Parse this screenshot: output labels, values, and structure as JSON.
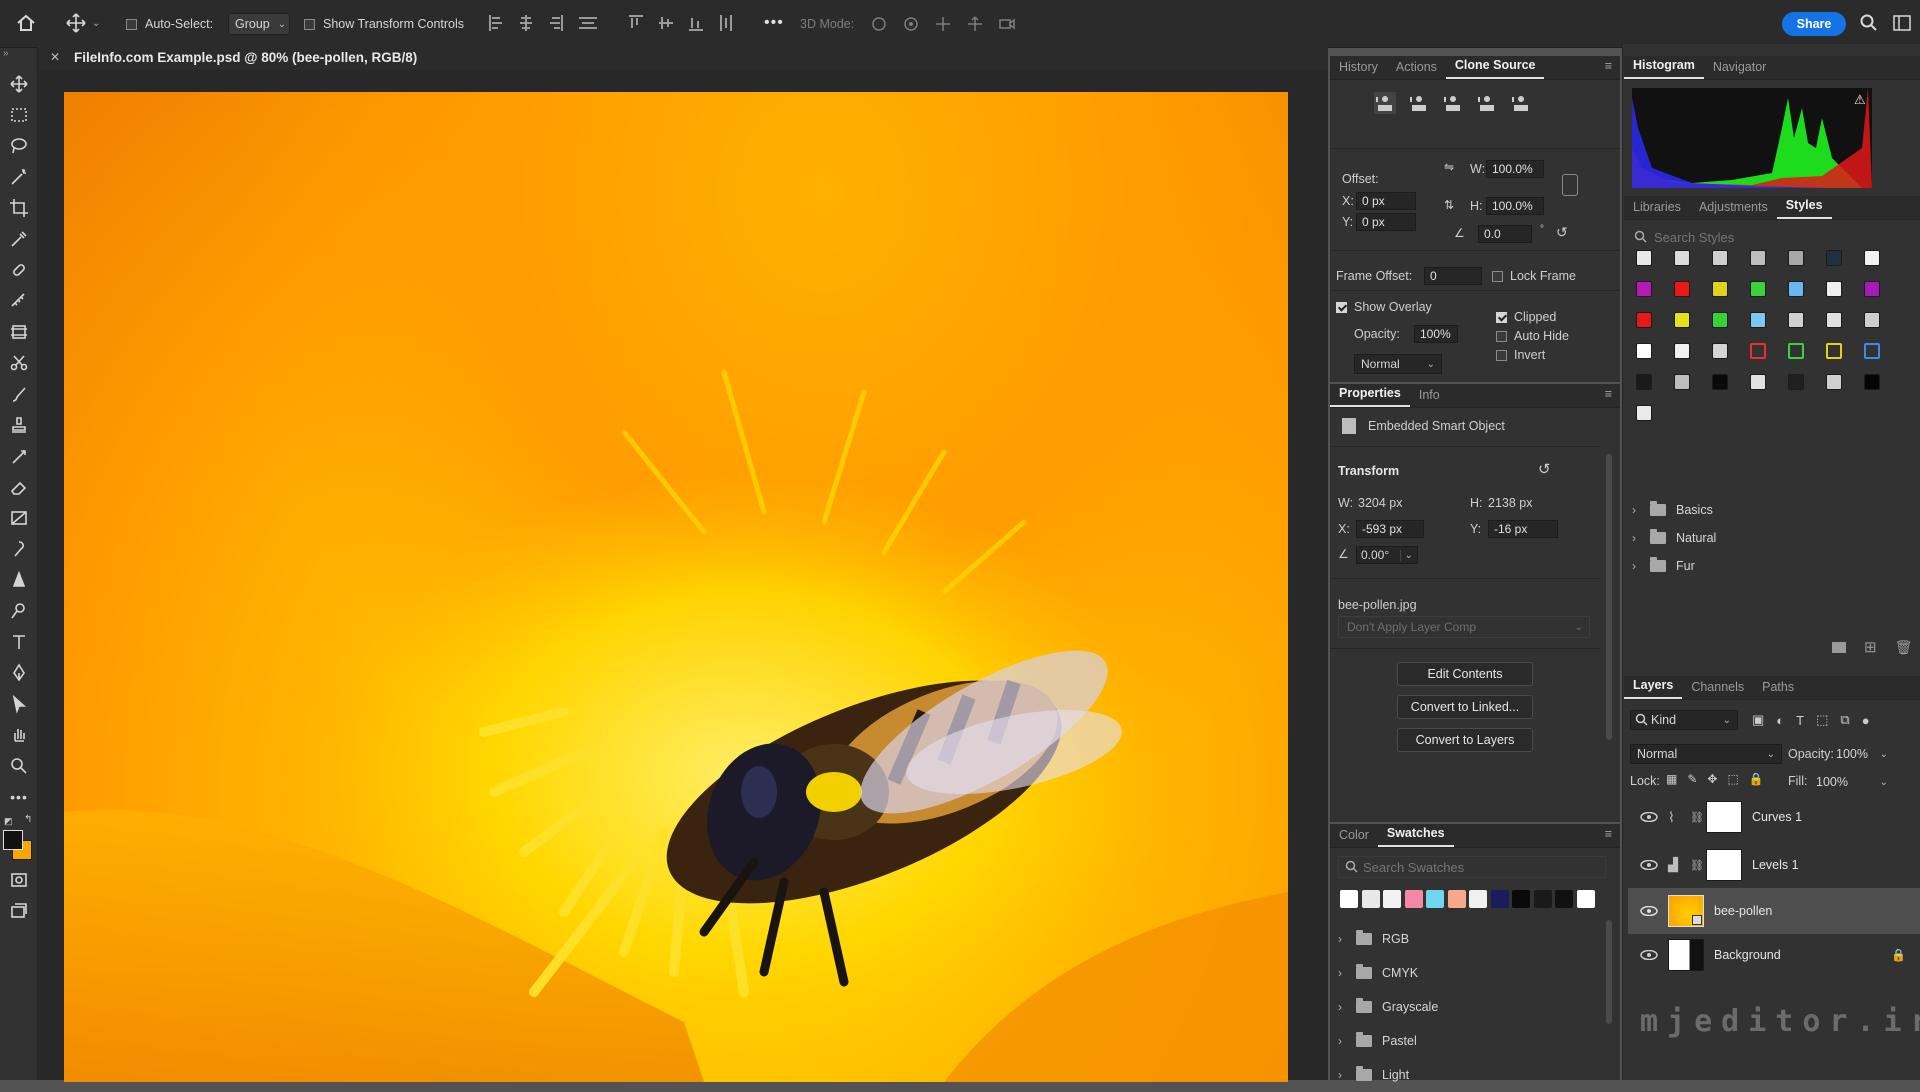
{
  "optionsBar": {
    "auto_select_label": "Auto-Select:",
    "auto_select_value": "Group",
    "show_transform_label": "Show Transform Controls",
    "mode3d_label": "3D Mode:",
    "share_label": "Share"
  },
  "document": {
    "tab_title": "FileInfo.com Example.psd @ 80% (bee-pollen, RGB/8)"
  },
  "cloneSource": {
    "tabs": [
      "History",
      "Actions",
      "Clone Source"
    ],
    "offset_label": "Offset:",
    "x_label": "X:",
    "x_value": "0 px",
    "y_label": "Y:",
    "y_value": "0 px",
    "w_label": "W:",
    "w_value": "100.0%",
    "h_label": "H:",
    "h_value": "100.0%",
    "angle_value": "0.0",
    "frame_offset_label": "Frame Offset:",
    "frame_offset_value": "0",
    "lock_frame_label": "Lock Frame",
    "show_overlay_label": "Show Overlay",
    "opacity_label": "Opacity:",
    "opacity_value": "100%",
    "blend_value": "Normal",
    "clipped_label": "Clipped",
    "auto_hide_label": "Auto Hide",
    "invert_label": "Invert"
  },
  "properties": {
    "tabs": [
      "Properties",
      "Info"
    ],
    "object_type": "Embedded Smart Object",
    "transform_label": "Transform",
    "w_label": "W:",
    "w_value": "3204 px",
    "h_label": "H:",
    "h_value": "2138 px",
    "x_label": "X:",
    "x_value": "-593 px",
    "y_label": "Y:",
    "y_value": "-16 px",
    "angle_value": "0.00°",
    "filename": "bee-pollen.jpg",
    "layer_comp": "Don't Apply Layer Comp",
    "edit_contents": "Edit Contents",
    "convert_linked": "Convert to Linked...",
    "convert_layers": "Convert to Layers"
  },
  "swatches": {
    "tabs": [
      "Color",
      "Swatches"
    ],
    "search_placeholder": "Search Swatches",
    "colors": [
      "#ffffff",
      "#e8e8e8",
      "#f2f2f2",
      "#f587a4",
      "#6fd6ee",
      "#f7a78a",
      "#f0f0f0",
      "#1c1c5c",
      "#0a0a0a",
      "#1a1a1a",
      "#111111",
      "#ffffff"
    ],
    "groups": [
      "RGB",
      "CMYK",
      "Grayscale",
      "Pastel",
      "Light"
    ]
  },
  "histogram": {
    "tabs": [
      "Histogram",
      "Navigator"
    ]
  },
  "styles": {
    "tabs": [
      "Libraries",
      "Adjustments",
      "Styles"
    ],
    "search_placeholder": "Search Styles",
    "groups": [
      "Basics",
      "Natural",
      "Fur"
    ]
  },
  "layers": {
    "tabs": [
      "Layers",
      "Channels",
      "Paths"
    ],
    "kind_label": "Kind",
    "blend_value": "Normal",
    "opacity_label": "Opacity:",
    "opacity_value": "100%",
    "lock_label": "Lock:",
    "fill_label": "Fill:",
    "fill_value": "100%",
    "items": [
      {
        "name": "Curves 1"
      },
      {
        "name": "Levels 1"
      },
      {
        "name": "bee-pollen"
      },
      {
        "name": "Background"
      }
    ]
  },
  "watermark": "mjeditor.ir"
}
